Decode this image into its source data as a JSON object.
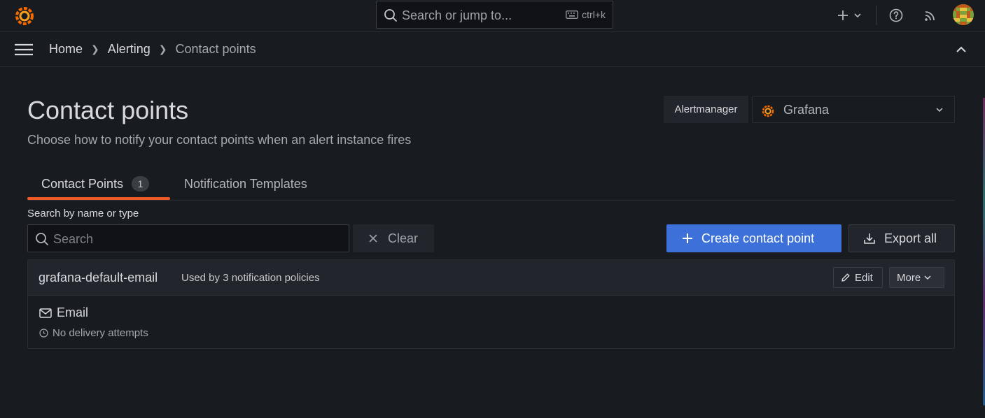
{
  "topbar": {
    "search_placeholder": "Search or jump to...",
    "search_shortcut": "ctrl+k"
  },
  "breadcrumb": {
    "items": [
      "Home",
      "Alerting"
    ],
    "current": "Contact points"
  },
  "header": {
    "title": "Contact points",
    "subtitle": "Choose how to notify your contact points when an alert instance fires"
  },
  "alertmanager": {
    "label": "Alertmanager",
    "selected": "Grafana"
  },
  "tabs": [
    {
      "label": "Contact Points",
      "count": "1",
      "active": true
    },
    {
      "label": "Notification Templates",
      "active": false
    }
  ],
  "filter": {
    "label": "Search by name or type",
    "placeholder": "Search",
    "clear_label": "Clear"
  },
  "actions": {
    "create_label": "Create contact point",
    "export_label": "Export all"
  },
  "contact_point": {
    "name": "grafana-default-email",
    "used_by": "Used by 3 notification policies",
    "edit_label": "Edit",
    "more_label": "More",
    "integration": "Email",
    "delivery_status": "No delivery attempts"
  },
  "colors": {
    "background": "#181b1f",
    "primary": "#3d71d9",
    "tab_underline": "#f05a28",
    "brand_orange": "#f46800"
  }
}
